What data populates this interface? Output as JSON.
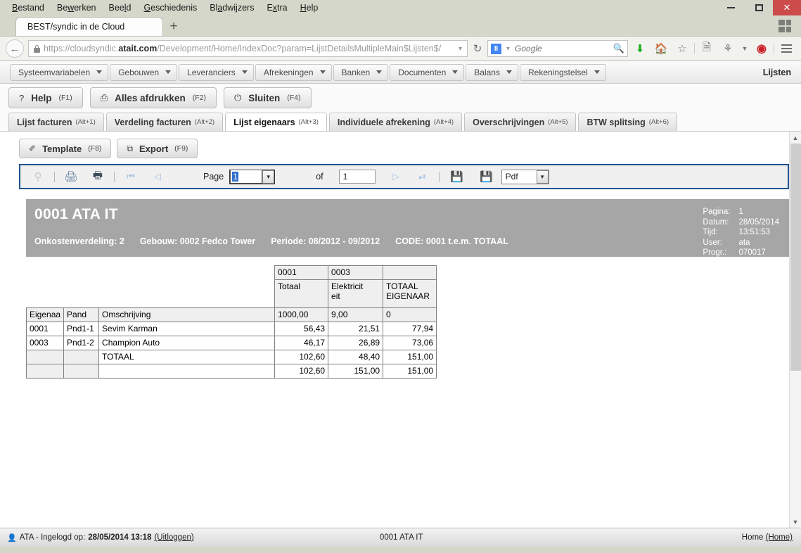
{
  "browser": {
    "menu": [
      "Bestand",
      "Bewerken",
      "Beeld",
      "Geschiedenis",
      "Bladwijzers",
      "Extra",
      "Help"
    ],
    "tab_title": "BEST/syndic in de Cloud",
    "new_tab_label": "+",
    "url_prefix": "https://cloudsyndic.",
    "url_domain": "atait.com",
    "url_suffix": "/Development/Home/IndexDoc?param=LijstDetailsMultipleMain$Lijsten$/",
    "search_placeholder": "Google",
    "search_engine_letter": "8",
    "window_buttons": {
      "minimize": "minimize",
      "maximize": "maximize",
      "close": "✕"
    }
  },
  "appmenu": {
    "items": [
      "Systeemvariabelen",
      "Gebouwen",
      "Leveranciers",
      "Afrekeningen",
      "Banken",
      "Documenten",
      "Balans",
      "Rekeningstelsel"
    ],
    "right_label": "Lijsten"
  },
  "actions": [
    {
      "icon": "?",
      "label": "Help",
      "key": "(F1)"
    },
    {
      "icon": "⎙",
      "label": "Alles afdrukken",
      "key": "(F2)"
    },
    {
      "icon": "⏻",
      "label": "Sluiten",
      "key": "(F4)"
    }
  ],
  "tabs": [
    {
      "label": "Lijst facturen",
      "alt": "(Alt+1)",
      "active": false
    },
    {
      "label": "Verdeling facturen",
      "alt": "(Alt+2)",
      "active": false
    },
    {
      "label": "Lijst eigenaars",
      "alt": "(Alt+3)",
      "active": true
    },
    {
      "label": "Individuele afrekening",
      "alt": "(Alt+4)",
      "active": false
    },
    {
      "label": "Overschrijvingen",
      "alt": "(Alt+5)",
      "active": false
    },
    {
      "label": "BTW splitsing",
      "alt": "(Alt+6)",
      "active": false
    }
  ],
  "doc_buttons": [
    {
      "icon": "✐",
      "label": "Template",
      "key": "(F8)"
    },
    {
      "icon": "⧉",
      "label": "Export",
      "key": "(F9)"
    }
  ],
  "report_toolbar": {
    "page_label": "Page",
    "page_value": "1",
    "of_label": "of",
    "total_pages": "1",
    "format_value": "Pdf",
    "icons": {
      "stack": "❐",
      "print": "⎙",
      "print_page": "⎙",
      "first": "⏮",
      "prev": "◁",
      "next": "▷",
      "last": "⏭",
      "save": "ὋE",
      "export": "ὋE"
    }
  },
  "report": {
    "title": "0001  ATA IT",
    "subtitle": [
      "Onkostenverdeling: 2",
      "Gebouw: 0002 Fedco Tower",
      "Periode: 08/2012 - 09/2012",
      "CODE: 0001 t.e.m. TOTAAL"
    ],
    "meta": [
      {
        "key": "Pagina:",
        "value": "1"
      },
      {
        "key": "Datum:",
        "value": "28/05/2014"
      },
      {
        "key": "Tijd:",
        "value": "13:51:53"
      },
      {
        "key": "User:",
        "value": "ata"
      },
      {
        "key": "Progr.:",
        "value": "070017"
      }
    ],
    "table": {
      "code_row": [
        "0001",
        "0003",
        ""
      ],
      "name_row": [
        "Totaal",
        "Elektricit\neit",
        "TOTAAL\nEIGENAAR"
      ],
      "headers": [
        "Eigenaa",
        "Pand",
        "Omschrijving"
      ],
      "header_values": [
        "1000,00",
        "9,00",
        "0"
      ],
      "rows": [
        {
          "eigenaar": "0001",
          "pand": "Pnd1-1",
          "omschrijving": "Sevim Karman",
          "v1": "56,43",
          "v2": "21,51",
          "v3": "77,94"
        },
        {
          "eigenaar": "0003",
          "pand": "Pnd1-2",
          "omschrijving": "Champion Auto",
          "v1": "46,17",
          "v2": "26,89",
          "v3": "73,06"
        },
        {
          "eigenaar": "",
          "pand": "",
          "omschrijving": "TOTAAL",
          "v1": "102,60",
          "v2": "48,40",
          "v3": "151,00"
        },
        {
          "eigenaar": "",
          "pand": "",
          "omschrijving": "",
          "v1": "102,60",
          "v2": "151,00",
          "v3": "151,00"
        }
      ]
    }
  },
  "statusbar": {
    "user_prefix": "ATA - Ingelogd op:",
    "datetime": "28/05/2014 13:18",
    "logout": "(Uitloggen)",
    "center": "0001 ATA IT",
    "right_plain": "Home ",
    "right_link": "(Home)"
  }
}
